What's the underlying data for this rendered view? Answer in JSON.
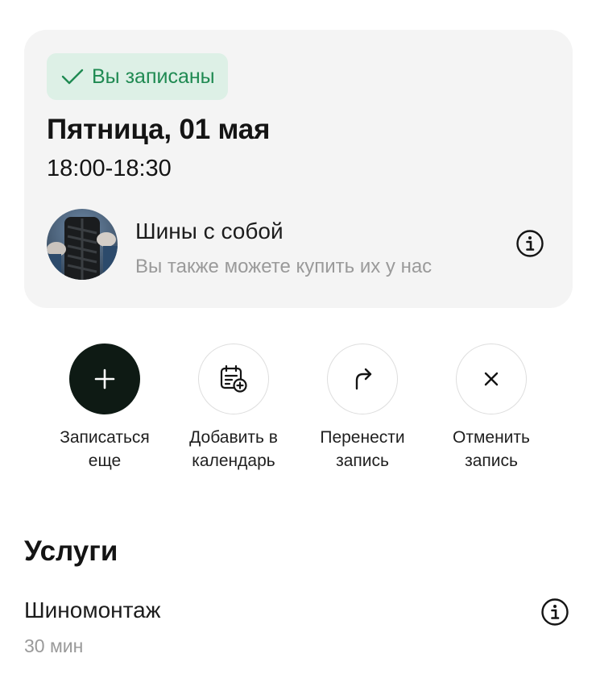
{
  "booking": {
    "status_label": "Вы записаны",
    "status_color": "#1f8a52",
    "date_title": "Пятница, 01 мая",
    "time_range": "18:00-18:30",
    "tires": {
      "title": "Шины с собой",
      "subtitle": "Вы также можете купить их у нас",
      "image": "tire-photo",
      "info_icon": "info-icon"
    }
  },
  "actions": [
    {
      "icon": "plus-icon",
      "line1": "Записаться",
      "line2": "еще"
    },
    {
      "icon": "calendar-add-icon",
      "line1": "Добавить в",
      "line2": "календарь"
    },
    {
      "icon": "reschedule-arrow-icon",
      "line1": "Перенести",
      "line2": "запись"
    },
    {
      "icon": "close-icon",
      "line1": "Отменить",
      "line2": "запись"
    }
  ],
  "services": {
    "title": "Услуги",
    "items": [
      {
        "name": "Шиномонтаж",
        "duration": "30 мин",
        "info_icon": "info-icon"
      }
    ]
  }
}
